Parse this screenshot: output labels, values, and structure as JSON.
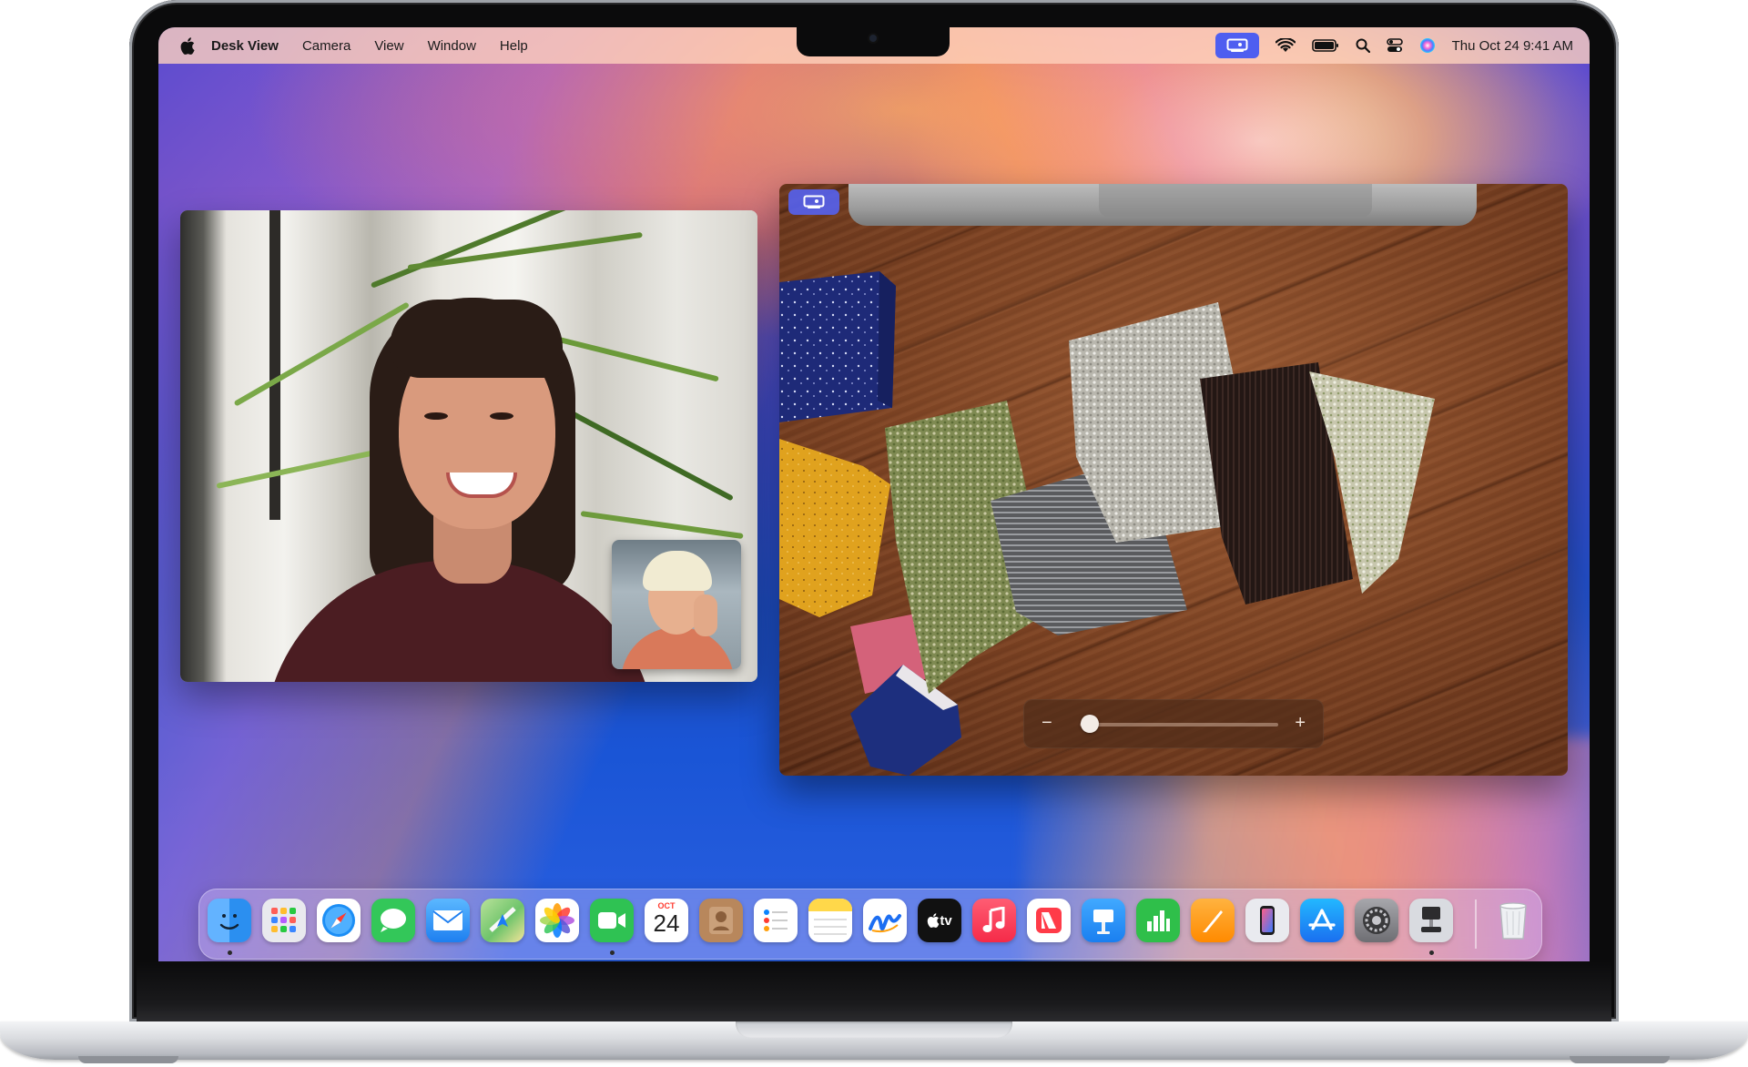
{
  "menubar": {
    "app_name": "Desk View",
    "items": [
      "Camera",
      "View",
      "Window",
      "Help"
    ],
    "clock": "Thu Oct 24  9:41 AM"
  },
  "dock": {
    "calendar": {
      "month": "OCT",
      "day": "24"
    },
    "tv_label": "tv",
    "apps": [
      {
        "name": "finder",
        "color": "#2b8ff0"
      },
      {
        "name": "launchpad",
        "color": "#e9e9ee"
      },
      {
        "name": "safari",
        "color": "#1c8ef5"
      },
      {
        "name": "messages",
        "color": "#33c759"
      },
      {
        "name": "mail",
        "color": "#2d9df5"
      },
      {
        "name": "maps",
        "color": "#6fc46b"
      },
      {
        "name": "photos",
        "color": "#ffffff"
      },
      {
        "name": "facetime",
        "color": "#2fc253"
      },
      {
        "name": "calendar",
        "color": "#ffffff"
      },
      {
        "name": "contacts",
        "color": "#b8875c"
      },
      {
        "name": "reminders",
        "color": "#ffffff"
      },
      {
        "name": "notes",
        "color": "#ffd84a"
      },
      {
        "name": "freeform",
        "color": "#ffffff"
      },
      {
        "name": "tv",
        "color": "#111111"
      },
      {
        "name": "music",
        "color": "#fa3a55"
      },
      {
        "name": "news",
        "color": "#ffffff"
      },
      {
        "name": "keynote",
        "color": "#1a8ff0"
      },
      {
        "name": "numbers",
        "color": "#2fbf4a"
      },
      {
        "name": "pages",
        "color": "#ff9f0a"
      },
      {
        "name": "iphone-mirroring",
        "color": "#e9eaef"
      },
      {
        "name": "app-store",
        "color": "#1a8ff5"
      },
      {
        "name": "system-settings",
        "color": "#8e8e93"
      },
      {
        "name": "desk-view",
        "color": "#d9dbe0"
      },
      {
        "name": "trash",
        "color": "#e7e8ea"
      }
    ]
  },
  "deskview": {
    "slider_minus": "−",
    "slider_plus": "+",
    "zoom_level": 0.05
  },
  "colors": {
    "accent": "#4e5ef0"
  }
}
